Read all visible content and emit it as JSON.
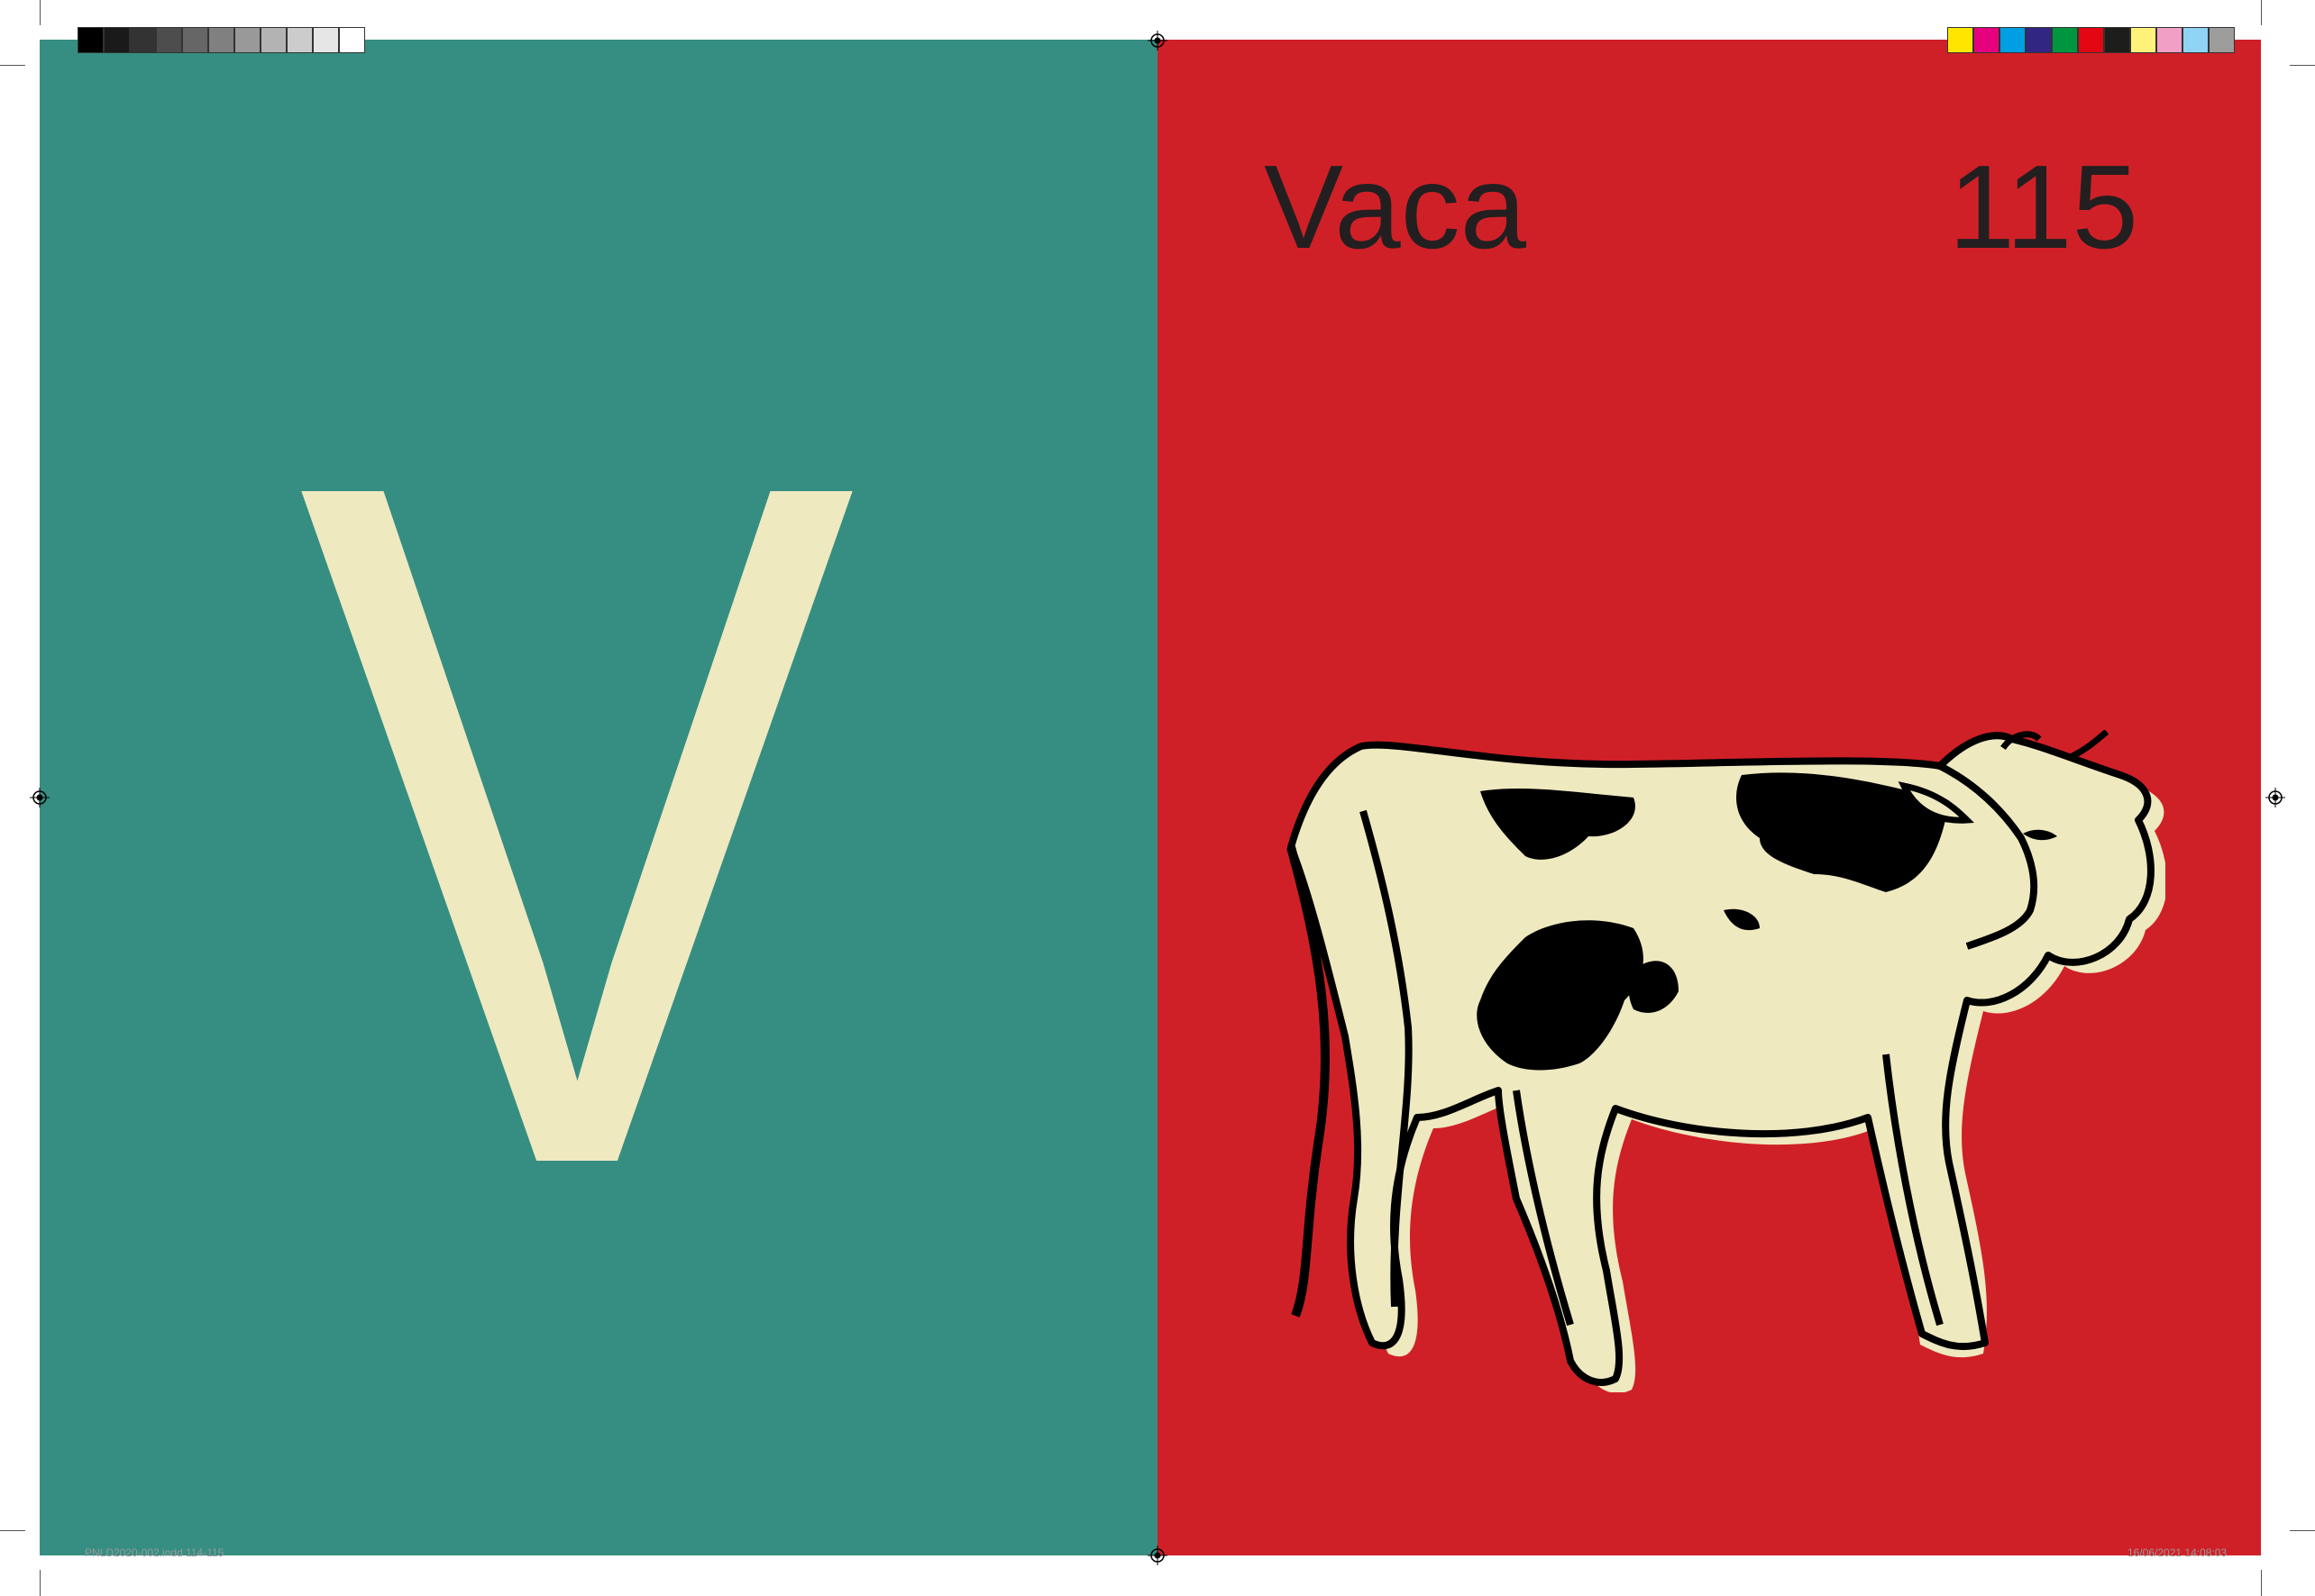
{
  "colors": {
    "left_page_bg": "#368e82",
    "right_page_bg": "#d02027",
    "letter_color": "#efe9c0",
    "text_dark": "#231f20",
    "cow_fill": "#efe9c0",
    "cow_outline": "#000000"
  },
  "left_page": {
    "letter": "V"
  },
  "right_page": {
    "title": "Vaca",
    "page_number": "115",
    "illustration": "cow-illustration"
  },
  "print_marks": {
    "grayscale_swatches": [
      "#000000",
      "#1a1a1a",
      "#333333",
      "#4d4d4d",
      "#666666",
      "#808080",
      "#999999",
      "#b3b3b3",
      "#cccccc",
      "#e6e6e6",
      "#ffffff"
    ],
    "color_swatches": [
      "#ffe600",
      "#e6007e",
      "#009fe3",
      "#312783",
      "#009640",
      "#e30613",
      "#1d1d1b",
      "#fff27a",
      "#f29fc5",
      "#8fd3f5",
      "#9d9d9c"
    ],
    "slug_left": "PNLD2020-002.indd   114-115",
    "slug_right": "16/06/2021   14:08:03"
  }
}
